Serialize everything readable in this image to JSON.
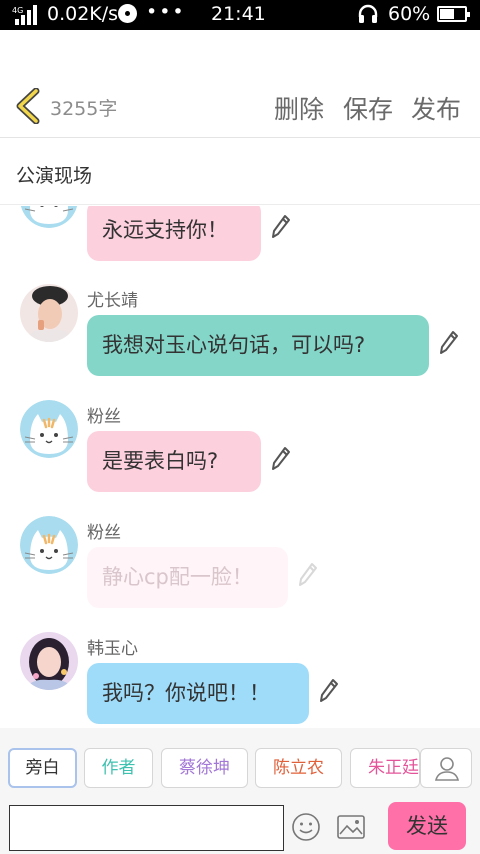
{
  "status_bar": {
    "net_tag": "4G",
    "speed": "0.02K/s",
    "time": "21:41",
    "battery": "60%",
    "overflow": "•••"
  },
  "header": {
    "word_count": "3255字",
    "delete_label": "删除",
    "save_label": "保存",
    "publish_label": "发布"
  },
  "title": "公演现场",
  "messages": [
    {
      "sender": "",
      "text": "永远支持你！",
      "avatar": "cat-avatar",
      "color": "#fdd0de"
    },
    {
      "sender": "尤长靖",
      "text": "我想对玉心说句话，可以吗?",
      "avatar": "man-avatar",
      "color": "#84d6c9"
    },
    {
      "sender": "粉丝",
      "text": "是要表白吗?",
      "avatar": "cat-avatar",
      "color": "#fdd0de"
    },
    {
      "sender": "粉丝",
      "text": "静心cp配一脸！",
      "avatar": "cat-avatar",
      "color": "#fff4f7"
    },
    {
      "sender": "韩玉心",
      "text": "我吗？你说吧！！",
      "avatar": "girl-avatar",
      "color": "#9fdcf9"
    }
  ],
  "roles": [
    {
      "label": "旁白",
      "color": "#333333"
    },
    {
      "label": "作者",
      "color": "#3fc1b0"
    },
    {
      "label": "蔡徐坤",
      "color": "#a277d6"
    },
    {
      "label": "陈立农",
      "color": "#e0603a"
    },
    {
      "label": "朱正廷",
      "color": "#e3559a"
    }
  ],
  "input": {
    "value": "",
    "send_label": "发送"
  },
  "colors": {
    "send_button": "#ff6fa8",
    "back_arrow": "#f2d64b"
  }
}
